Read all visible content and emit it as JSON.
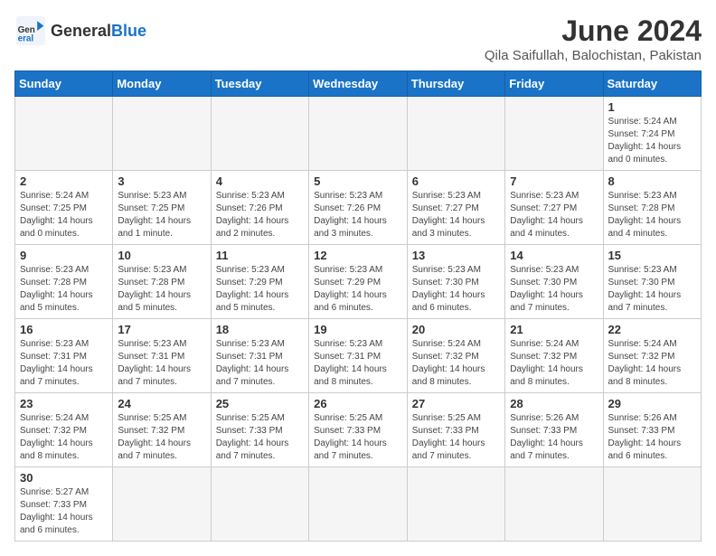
{
  "header": {
    "logo_general": "General",
    "logo_blue": "Blue",
    "title": "June 2024",
    "subtitle": "Qila Saifullah, Balochistan, Pakistan"
  },
  "weekdays": [
    "Sunday",
    "Monday",
    "Tuesday",
    "Wednesday",
    "Thursday",
    "Friday",
    "Saturday"
  ],
  "weeks": [
    [
      {
        "day": "",
        "info": ""
      },
      {
        "day": "",
        "info": ""
      },
      {
        "day": "",
        "info": ""
      },
      {
        "day": "",
        "info": ""
      },
      {
        "day": "",
        "info": ""
      },
      {
        "day": "",
        "info": ""
      },
      {
        "day": "1",
        "info": "Sunrise: 5:24 AM\nSunset: 7:24 PM\nDaylight: 14 hours\nand 0 minutes."
      }
    ],
    [
      {
        "day": "2",
        "info": "Sunrise: 5:24 AM\nSunset: 7:25 PM\nDaylight: 14 hours\nand 0 minutes."
      },
      {
        "day": "3",
        "info": "Sunrise: 5:23 AM\nSunset: 7:25 PM\nDaylight: 14 hours\nand 1 minute."
      },
      {
        "day": "4",
        "info": "Sunrise: 5:23 AM\nSunset: 7:26 PM\nDaylight: 14 hours\nand 2 minutes."
      },
      {
        "day": "5",
        "info": "Sunrise: 5:23 AM\nSunset: 7:26 PM\nDaylight: 14 hours\nand 3 minutes."
      },
      {
        "day": "6",
        "info": "Sunrise: 5:23 AM\nSunset: 7:27 PM\nDaylight: 14 hours\nand 3 minutes."
      },
      {
        "day": "7",
        "info": "Sunrise: 5:23 AM\nSunset: 7:27 PM\nDaylight: 14 hours\nand 4 minutes."
      },
      {
        "day": "8",
        "info": "Sunrise: 5:23 AM\nSunset: 7:28 PM\nDaylight: 14 hours\nand 4 minutes."
      }
    ],
    [
      {
        "day": "9",
        "info": "Sunrise: 5:23 AM\nSunset: 7:28 PM\nDaylight: 14 hours\nand 5 minutes."
      },
      {
        "day": "10",
        "info": "Sunrise: 5:23 AM\nSunset: 7:28 PM\nDaylight: 14 hours\nand 5 minutes."
      },
      {
        "day": "11",
        "info": "Sunrise: 5:23 AM\nSunset: 7:29 PM\nDaylight: 14 hours\nand 5 minutes."
      },
      {
        "day": "12",
        "info": "Sunrise: 5:23 AM\nSunset: 7:29 PM\nDaylight: 14 hours\nand 6 minutes."
      },
      {
        "day": "13",
        "info": "Sunrise: 5:23 AM\nSunset: 7:30 PM\nDaylight: 14 hours\nand 6 minutes."
      },
      {
        "day": "14",
        "info": "Sunrise: 5:23 AM\nSunset: 7:30 PM\nDaylight: 14 hours\nand 7 minutes."
      },
      {
        "day": "15",
        "info": "Sunrise: 5:23 AM\nSunset: 7:30 PM\nDaylight: 14 hours\nand 7 minutes."
      }
    ],
    [
      {
        "day": "16",
        "info": "Sunrise: 5:23 AM\nSunset: 7:31 PM\nDaylight: 14 hours\nand 7 minutes."
      },
      {
        "day": "17",
        "info": "Sunrise: 5:23 AM\nSunset: 7:31 PM\nDaylight: 14 hours\nand 7 minutes."
      },
      {
        "day": "18",
        "info": "Sunrise: 5:23 AM\nSunset: 7:31 PM\nDaylight: 14 hours\nand 7 minutes."
      },
      {
        "day": "19",
        "info": "Sunrise: 5:23 AM\nSunset: 7:31 PM\nDaylight: 14 hours\nand 8 minutes."
      },
      {
        "day": "20",
        "info": "Sunrise: 5:24 AM\nSunset: 7:32 PM\nDaylight: 14 hours\nand 8 minutes."
      },
      {
        "day": "21",
        "info": "Sunrise: 5:24 AM\nSunset: 7:32 PM\nDaylight: 14 hours\nand 8 minutes."
      },
      {
        "day": "22",
        "info": "Sunrise: 5:24 AM\nSunset: 7:32 PM\nDaylight: 14 hours\nand 8 minutes."
      }
    ],
    [
      {
        "day": "23",
        "info": "Sunrise: 5:24 AM\nSunset: 7:32 PM\nDaylight: 14 hours\nand 8 minutes."
      },
      {
        "day": "24",
        "info": "Sunrise: 5:25 AM\nSunset: 7:32 PM\nDaylight: 14 hours\nand 7 minutes."
      },
      {
        "day": "25",
        "info": "Sunrise: 5:25 AM\nSunset: 7:33 PM\nDaylight: 14 hours\nand 7 minutes."
      },
      {
        "day": "26",
        "info": "Sunrise: 5:25 AM\nSunset: 7:33 PM\nDaylight: 14 hours\nand 7 minutes."
      },
      {
        "day": "27",
        "info": "Sunrise: 5:25 AM\nSunset: 7:33 PM\nDaylight: 14 hours\nand 7 minutes."
      },
      {
        "day": "28",
        "info": "Sunrise: 5:26 AM\nSunset: 7:33 PM\nDaylight: 14 hours\nand 7 minutes."
      },
      {
        "day": "29",
        "info": "Sunrise: 5:26 AM\nSunset: 7:33 PM\nDaylight: 14 hours\nand 6 minutes."
      }
    ],
    [
      {
        "day": "30",
        "info": "Sunrise: 5:27 AM\nSunset: 7:33 PM\nDaylight: 14 hours\nand 6 minutes."
      },
      {
        "day": "",
        "info": ""
      },
      {
        "day": "",
        "info": ""
      },
      {
        "day": "",
        "info": ""
      },
      {
        "day": "",
        "info": ""
      },
      {
        "day": "",
        "info": ""
      },
      {
        "day": "",
        "info": ""
      }
    ]
  ]
}
